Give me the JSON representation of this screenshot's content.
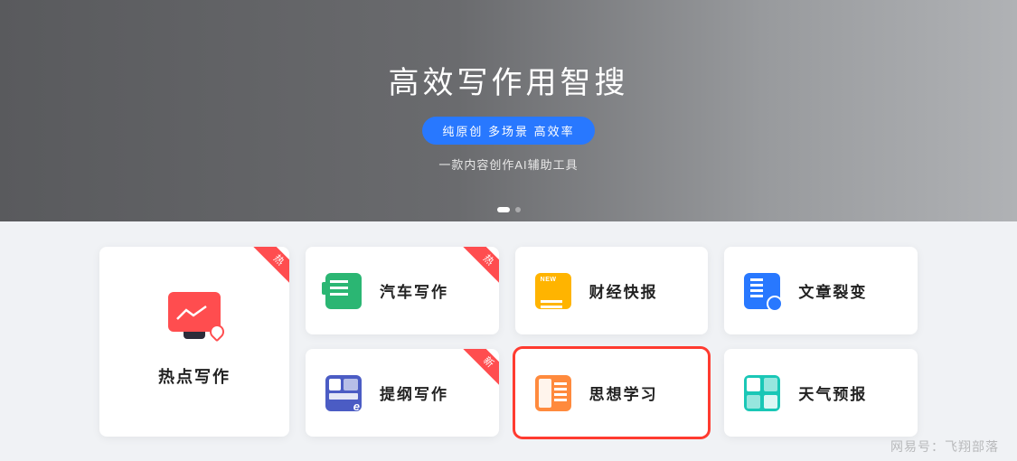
{
  "hero": {
    "title": "高效写作用智搜",
    "badge": "纯原创 多场景 高效率",
    "subtitle": "一款内容创作AI辅助工具"
  },
  "bigCard": {
    "label": "热点写作",
    "ribbon": "热"
  },
  "cards": [
    {
      "label": "汽车写作",
      "ribbon": "热",
      "icon": "car-icon"
    },
    {
      "label": "财经快报",
      "ribbon": "",
      "icon": "finance-icon"
    },
    {
      "label": "文章裂变",
      "ribbon": "",
      "icon": "split-icon"
    },
    {
      "label": "提纲写作",
      "ribbon": "新",
      "icon": "outline-icon"
    },
    {
      "label": "思想学习",
      "ribbon": "",
      "icon": "thinking-icon",
      "highlighted": true
    },
    {
      "label": "天气预报",
      "ribbon": "",
      "icon": "weather-icon"
    }
  ],
  "watermark": "网易号：飞翔部落"
}
